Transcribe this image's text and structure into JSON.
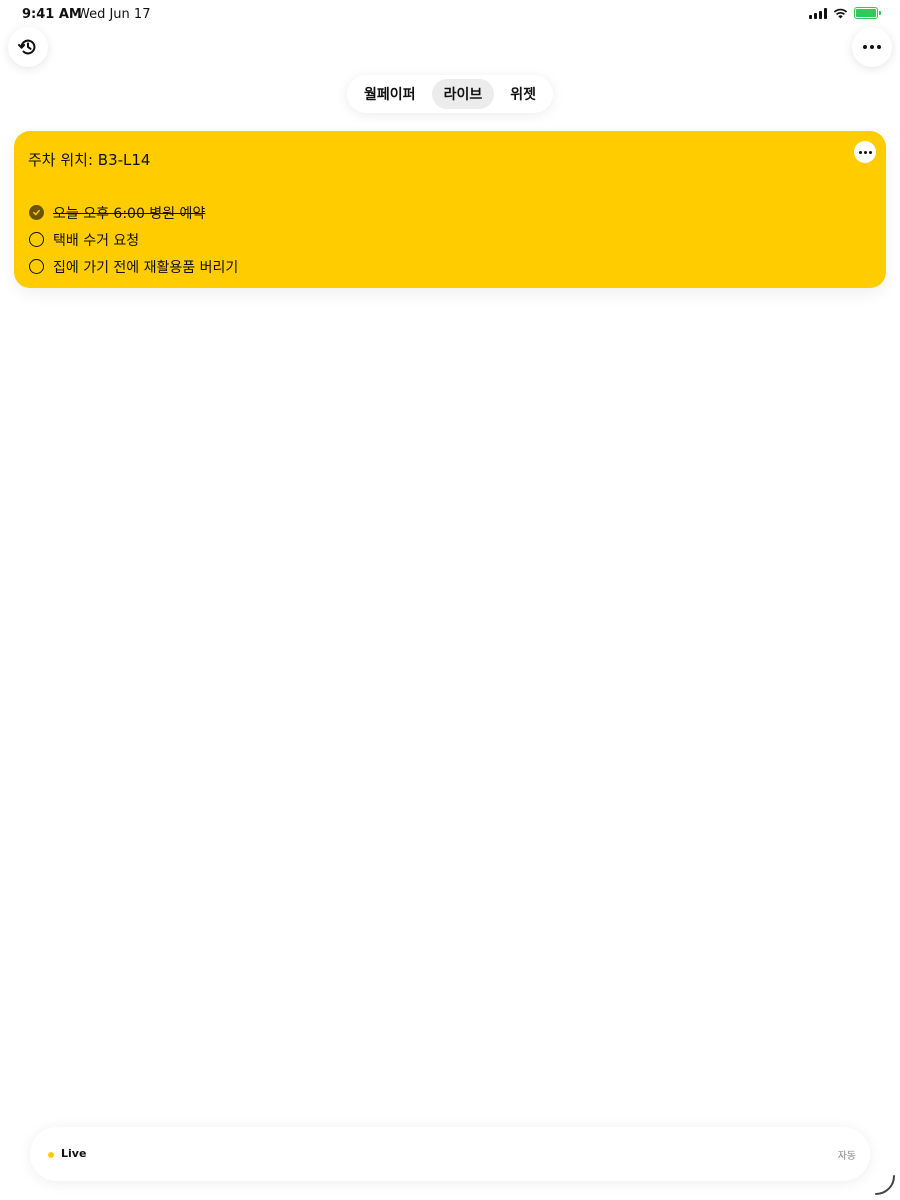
{
  "status_bar": {
    "time": "9:41 AM",
    "date": "Wed Jun 17",
    "battery_color": "#34c759"
  },
  "toolbar": {
    "history_icon": "history-icon",
    "more_icon": "more-horizontal-icon"
  },
  "tabs": [
    {
      "label": "월페이퍼",
      "active": false
    },
    {
      "label": "라이브",
      "active": true
    },
    {
      "label": "위젯",
      "active": false
    }
  ],
  "card": {
    "color": "#ffcc00",
    "title": "주차 위치: B3-L14",
    "items": [
      {
        "label": "오늘 오후 6:00 병원 예약",
        "done": true
      },
      {
        "label": "택배 수거 요청",
        "done": false
      },
      {
        "label": "집에 가기 전에 재활용품 버리기",
        "done": false
      }
    ]
  },
  "bottom_bar": {
    "live_label": "Live",
    "auto_label": "자동"
  }
}
